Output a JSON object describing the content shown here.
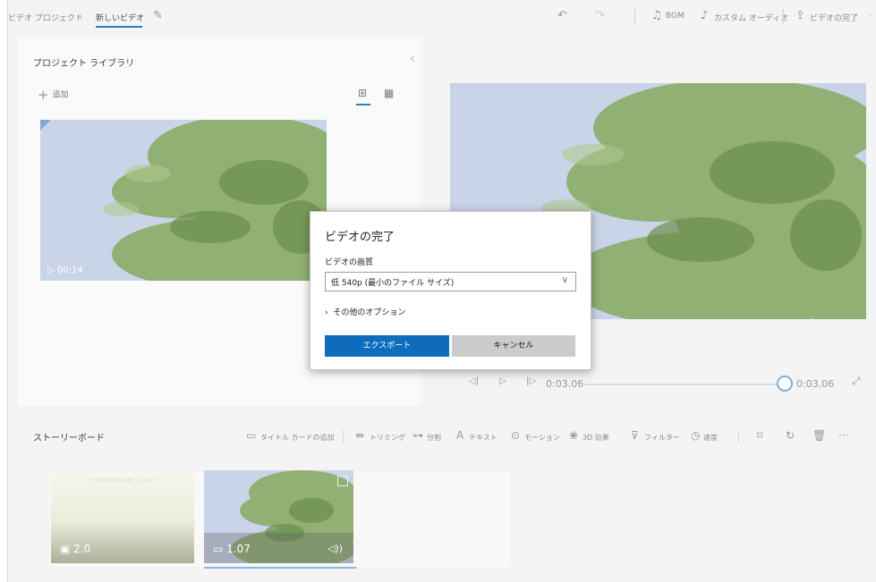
{
  "topbar": {
    "breadcrumb_root": "ビデオ プロジェクト",
    "breadcrumb_current": "新しいビデオ",
    "edit_icon": "pencil-icon",
    "undo_icon": "undo-icon",
    "redo_icon": "redo-icon",
    "bgm_label": "BGM",
    "custom_audio_label": "カスタム オーディオ",
    "finish_label": "ビデオの完了"
  },
  "library": {
    "title": "プロジェクト ライブラリ",
    "add_label": "追加",
    "clip_duration": "00:14"
  },
  "preview": {
    "current_time": "0:03.06",
    "total_time": "0:03.06",
    "progress": 1.0
  },
  "storyboard": {
    "title": "ストーリーボード",
    "tools": {
      "title_card": "タイトル カードの追加",
      "trim": "トリミング",
      "split": "分割",
      "text": "テキスト",
      "motion": "モーション",
      "effects3d": "3D 効果",
      "filter": "フィルター",
      "speed": "速度"
    },
    "cards": [
      {
        "duration": "2.0",
        "caption": "ビデオのタイトルをここに入力"
      },
      {
        "duration": "1.07"
      }
    ]
  },
  "dialog": {
    "title": "ビデオの完了",
    "quality_label": "ビデオの画質",
    "quality_value": "低 540p (最小のファイル サイズ)",
    "more_options": "その他のオプション",
    "export_label": "エクスポート",
    "cancel_label": "キャンセル"
  },
  "colors": {
    "accent": "#0f6cbd",
    "sky": "#c3cfe6",
    "foliage": "#5b8a34"
  }
}
